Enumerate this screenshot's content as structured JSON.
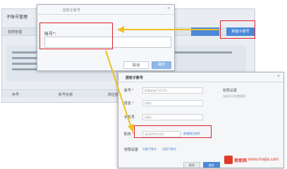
{
  "background_page": {
    "title": "子账号管理",
    "tab": "权限管理",
    "button_new": "新建子账号",
    "table_headers": [
      "序号",
      "账号名称",
      "岗位部门"
    ]
  },
  "dialog_top": {
    "title": "授权子账号",
    "close": "×",
    "field_label": "账号*：",
    "input_value": "",
    "cancel_label": "取消",
    "ok_label": "确定"
  },
  "dialog_bottom": {
    "title": "授权子账号",
    "close": "×",
    "fields": [
      {
        "label": "账号",
        "required": true,
        "placeholder": "邮箱或者手机号码"
      },
      {
        "label": "姓名",
        "required": true,
        "placeholder": "请输入"
      },
      {
        "label": "手机号",
        "required": false,
        "placeholder": "请输入"
      },
      {
        "label": "职务",
        "required": true,
        "placeholder": "请选择岗位角色"
      }
    ],
    "role_link": "新增岗位角色",
    "permission_label": "权限设置",
    "permission_links": [
      "分配子账号",
      "分配子账号"
    ],
    "side_title": "权限设置",
    "side_hint": "勾选后可设置权限",
    "cancel_label": "取消",
    "ok_label": "确定"
  },
  "watermark": {
    "brand": "卖家网",
    "url": "www.maijia.com"
  },
  "colors": {
    "highlight": "#e0222a",
    "arrow": "#f0c020",
    "primary": "#4b89d8"
  }
}
